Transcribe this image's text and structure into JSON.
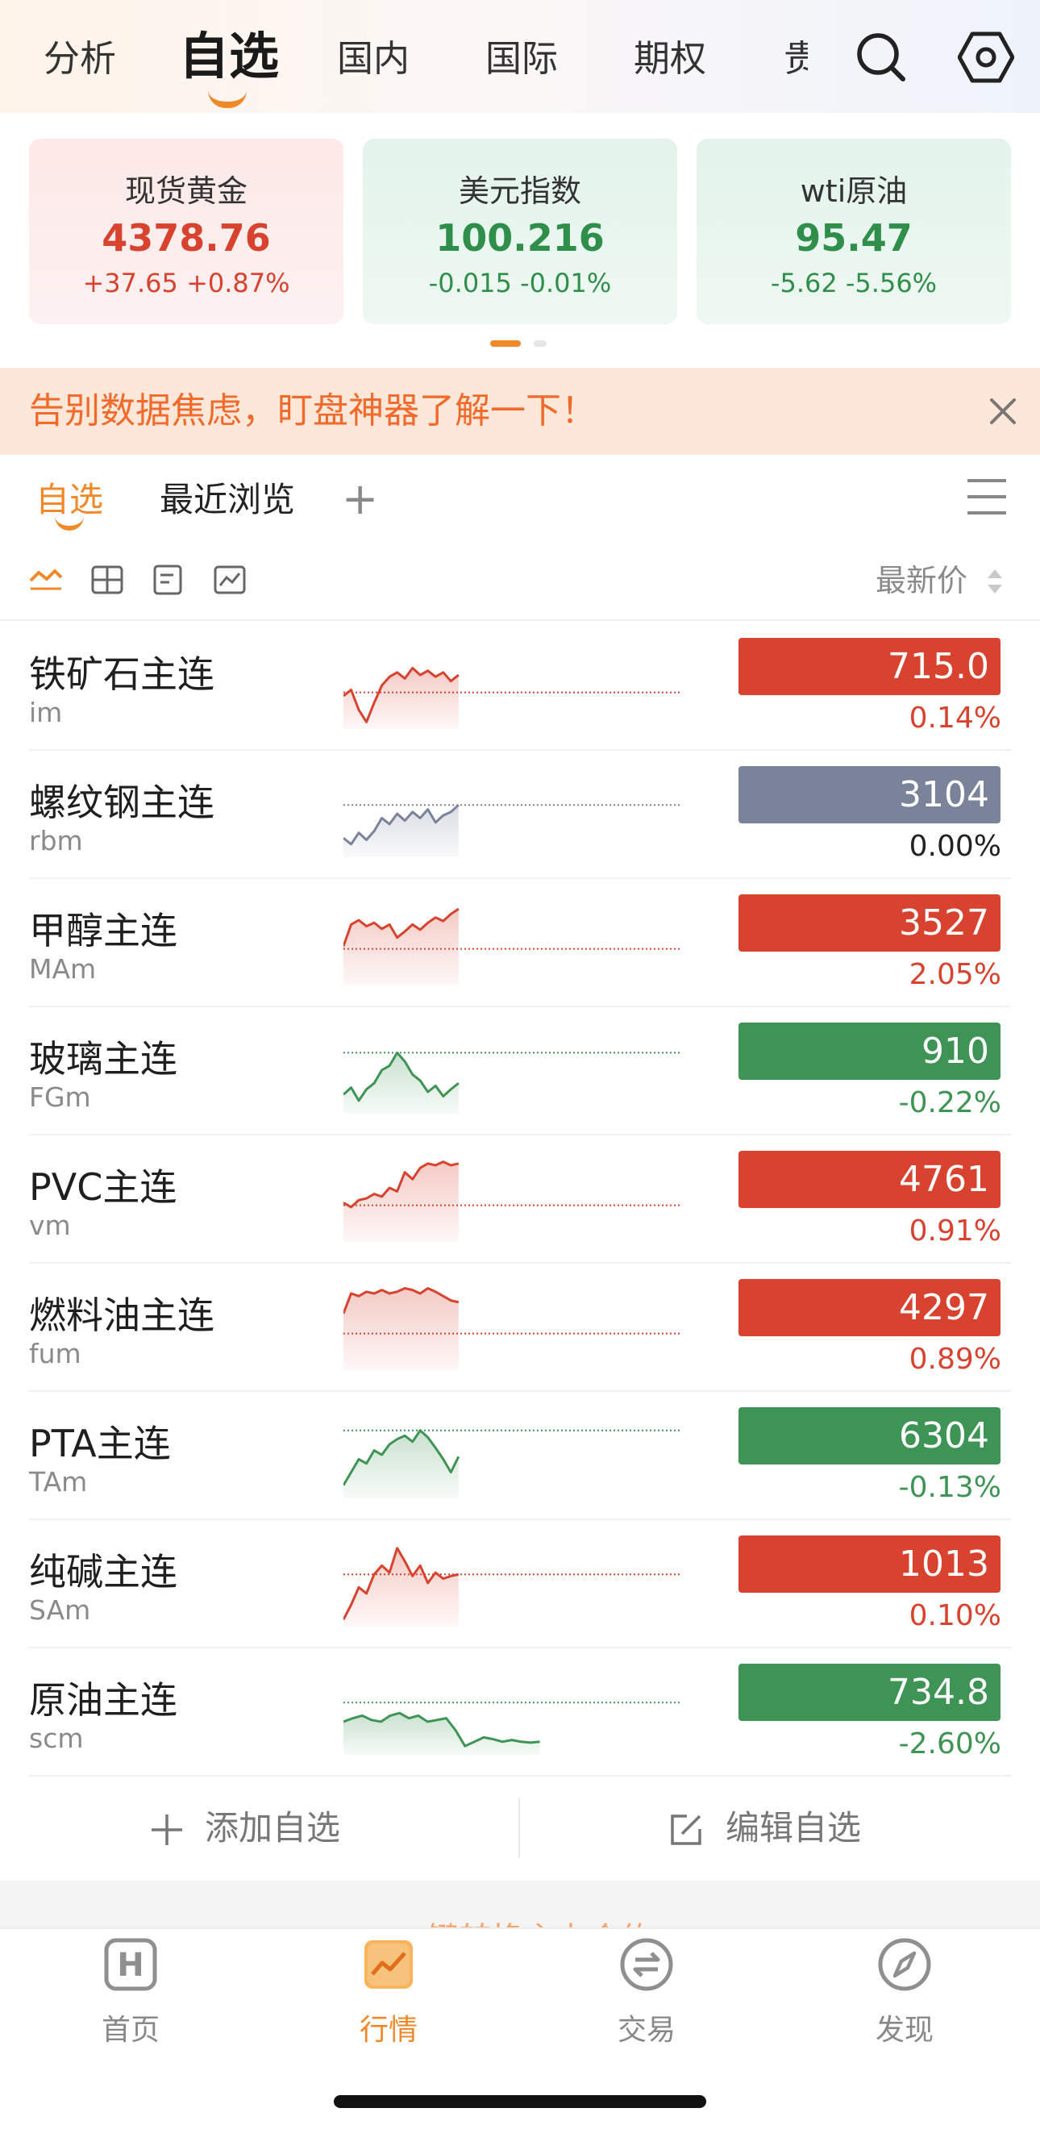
{
  "nav": {
    "tabs": [
      {
        "label": "分析"
      },
      {
        "label": "自选"
      },
      {
        "label": "国内"
      },
      {
        "label": "国际"
      },
      {
        "label": "期权"
      }
    ],
    "cut_tab": "贵",
    "icons": [
      "search-icon",
      "settings-icon"
    ]
  },
  "tickers": [
    {
      "name": "现货黄金",
      "price": "4378.76",
      "change": "+37.65 +0.87%",
      "trend": "up"
    },
    {
      "name": "美元指数",
      "price": "100.216",
      "change": "-0.015 -0.01%",
      "trend": "down"
    },
    {
      "name": "wti原油",
      "price": "95.47",
      "change": "-5.62 -5.56%",
      "trend": "down"
    }
  ],
  "carousel": {
    "pages": 2,
    "active": 1
  },
  "banner": {
    "text": "告别数据焦虑，盯盘神器了解一下！",
    "close_icon": "close-icon"
  },
  "subtabs": {
    "active": "自选",
    "recent": "最近浏览",
    "add": "+"
  },
  "toolbar": {
    "view_icons": [
      "sparkline-view-icon",
      "grid-view-icon",
      "card-view-icon",
      "chart-view-icon"
    ],
    "sort_label": "最新价"
  },
  "watchlist": [
    {
      "name": "铁矿石主连",
      "code": "im",
      "price": "715.0",
      "pct": "0.14%",
      "trend": "up",
      "spark": [
        0.62,
        0.55,
        0.78,
        0.92,
        0.7,
        0.5,
        0.4,
        0.35,
        0.42,
        0.3,
        0.38,
        0.33,
        0.4,
        0.35,
        0.45,
        0.38
      ],
      "baseline": 0.58,
      "progress": 0.34
    },
    {
      "name": "螺纹钢主连",
      "code": "rbm",
      "price": "3104",
      "pct": "0.00%",
      "trend": "flat",
      "spark": [
        0.78,
        0.85,
        0.72,
        0.8,
        0.7,
        0.55,
        0.62,
        0.5,
        0.58,
        0.48,
        0.55,
        0.45,
        0.6,
        0.52,
        0.48,
        0.4
      ],
      "baseline": 0.4,
      "progress": 0.34
    },
    {
      "name": "甲醇主连",
      "code": "MAm",
      "price": "3527",
      "pct": "2.05%",
      "trend": "up",
      "spark": [
        0.55,
        0.3,
        0.25,
        0.32,
        0.28,
        0.35,
        0.3,
        0.45,
        0.38,
        0.3,
        0.36,
        0.28,
        0.22,
        0.26,
        0.18,
        0.12
      ],
      "baseline": 0.58,
      "progress": 0.34
    },
    {
      "name": "玻璃主连",
      "code": "FGm",
      "price": "910",
      "pct": "-0.22%",
      "trend": "down",
      "spark": [
        0.78,
        0.7,
        0.85,
        0.72,
        0.65,
        0.5,
        0.45,
        0.3,
        0.4,
        0.55,
        0.62,
        0.75,
        0.68,
        0.8,
        0.72,
        0.65
      ],
      "baseline": 0.3,
      "progress": 0.34
    },
    {
      "name": "PVC主连",
      "code": "vm",
      "price": "4761",
      "pct": "0.91%",
      "trend": "up",
      "spark": [
        0.55,
        0.6,
        0.52,
        0.5,
        0.45,
        0.48,
        0.38,
        0.42,
        0.2,
        0.28,
        0.15,
        0.1,
        0.12,
        0.08,
        0.12,
        0.1
      ],
      "baseline": 0.58,
      "progress": 0.34
    },
    {
      "name": "燃料油主连",
      "code": "fum",
      "price": "4297",
      "pct": "0.89%",
      "trend": "up",
      "spark": [
        0.35,
        0.12,
        0.15,
        0.1,
        0.12,
        0.08,
        0.12,
        0.1,
        0.06,
        0.08,
        0.12,
        0.06,
        0.1,
        0.15,
        0.2,
        0.22
      ],
      "baseline": 0.58,
      "progress": 0.34
    },
    {
      "name": "PTA主连",
      "code": "TAm",
      "price": "6304",
      "pct": "-0.13%",
      "trend": "down",
      "spark": [
        0.85,
        0.7,
        0.55,
        0.6,
        0.45,
        0.5,
        0.38,
        0.32,
        0.28,
        0.35,
        0.22,
        0.3,
        0.42,
        0.55,
        0.7,
        0.52
      ],
      "baseline": 0.22,
      "progress": 0.34
    },
    {
      "name": "纯碱主连",
      "code": "SAm",
      "price": "1013",
      "pct": "0.10%",
      "trend": "up",
      "spark": [
        0.92,
        0.75,
        0.55,
        0.62,
        0.4,
        0.3,
        0.38,
        0.1,
        0.25,
        0.42,
        0.3,
        0.5,
        0.38,
        0.45,
        0.42,
        0.4
      ],
      "baseline": 0.4,
      "progress": 0.34
    },
    {
      "name": "原油主连",
      "code": "scm",
      "price": "734.8",
      "pct": "-2.60%",
      "trend": "down",
      "spark": [
        0.62,
        0.58,
        0.55,
        0.6,
        0.62,
        0.55,
        0.52,
        0.58,
        0.55,
        0.62,
        0.6,
        0.58,
        0.72,
        0.9,
        0.85,
        0.8,
        0.82,
        0.85,
        0.83,
        0.85,
        0.86,
        0.85
      ],
      "baseline": 0.4,
      "progress": 0.58
    }
  ],
  "actions": {
    "add": "添加自选",
    "edit": "编辑自选"
  },
  "promo_text": "一键转换主力合约 >",
  "tabbar": [
    {
      "label": "首页",
      "icon": "home-icon",
      "active": false
    },
    {
      "label": "行情",
      "icon": "market-icon",
      "active": true
    },
    {
      "label": "交易",
      "icon": "trade-icon",
      "active": false
    },
    {
      "label": "发现",
      "icon": "discover-icon",
      "active": false
    }
  ],
  "colors": {
    "up": "#d8432f",
    "down": "#3e9454",
    "flat": "#7b839b",
    "accent": "#f0892a"
  }
}
